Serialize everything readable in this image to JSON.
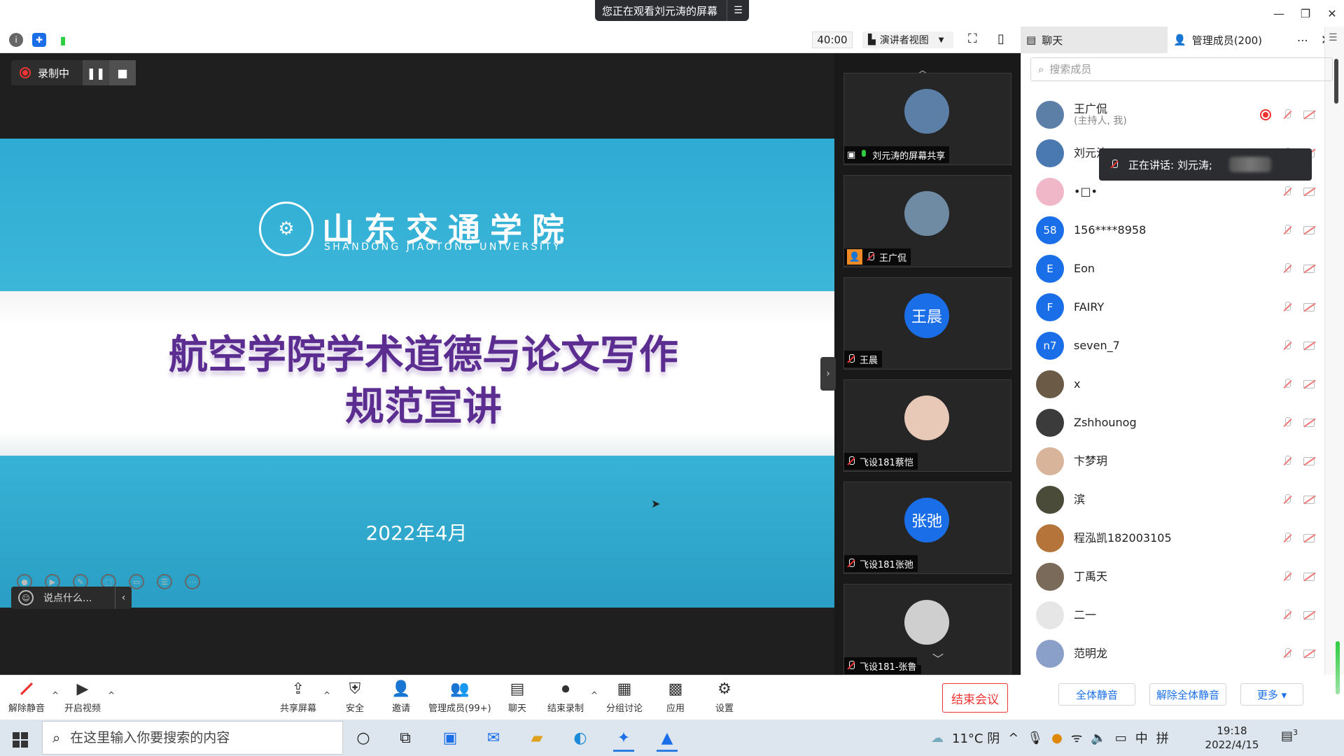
{
  "banner": {
    "text": "您正在观看刘元涛的屏幕",
    "menu_icon": "menu-icon"
  },
  "toolbar": {
    "timer": "40:00",
    "view_mode": "演讲者视图"
  },
  "recording": {
    "label": "录制中"
  },
  "slide": {
    "university_cn": "山东交通学院",
    "university_en": "SHANDONG JIAOTONG UNIVERSITY",
    "title_line1": "航空学院学术道德与论文写作",
    "title_line2": "规范宣讲",
    "date": "2022年4月"
  },
  "chat_input": {
    "placeholder": "说点什么..."
  },
  "gallery": [
    {
      "name": "刘元涛的屏幕共享",
      "avatar_text": "",
      "avatar_color": "#5b7fa6",
      "mic": "on",
      "sharing": true
    },
    {
      "name": "王广侃",
      "avatar_text": "",
      "avatar_color": "#6f8aa3",
      "mic": "off",
      "host_badge": true
    },
    {
      "name": "王晨",
      "avatar_text": "王晨",
      "avatar_color": "#1a6fe8",
      "mic": "off"
    },
    {
      "name": "飞设181蔡恺",
      "avatar_text": "",
      "avatar_color": "#e8c9b8",
      "mic": "off"
    },
    {
      "name": "飞设181张弛",
      "avatar_text": "张弛",
      "avatar_color": "#1a6fe8",
      "mic": "off"
    },
    {
      "name": "飞设181-张鲁",
      "avatar_text": "",
      "avatar_color": "#cfcfcf",
      "mic": "off"
    }
  ],
  "panel": {
    "tab_chat": "聊天",
    "tab_members": "管理成员(200)",
    "search_placeholder": "搜索成员",
    "speaking": "正在讲话: 刘元涛;",
    "members": [
      {
        "name": "王广侃",
        "sub": "(主持人, 我)",
        "avatar_text": "",
        "avatar_color": "#5b7fa6",
        "recording": true
      },
      {
        "name": "刘元涛",
        "sub": "",
        "avatar_text": "",
        "avatar_color": "#4a78b0"
      },
      {
        "name": "•□•",
        "sub": "",
        "avatar_text": "",
        "avatar_color": "#f0b7c8"
      },
      {
        "name": "156****8958",
        "sub": "",
        "avatar_text": "58",
        "avatar_color": "#1a6fe8"
      },
      {
        "name": "Eon",
        "sub": "",
        "avatar_text": "E",
        "avatar_color": "#1a6fe8"
      },
      {
        "name": "FAIRY",
        "sub": "",
        "avatar_text": "F",
        "avatar_color": "#1a6fe8"
      },
      {
        "name": "seven_7",
        "sub": "",
        "avatar_text": "n7",
        "avatar_color": "#1a6fe8"
      },
      {
        "name": "x",
        "sub": "",
        "avatar_text": "",
        "avatar_color": "#6b5a45"
      },
      {
        "name": "Zshhounog",
        "sub": "",
        "avatar_text": "",
        "avatar_color": "#3b3b3b"
      },
      {
        "name": "卞梦玥",
        "sub": "",
        "avatar_text": "",
        "avatar_color": "#d8b49a"
      },
      {
        "name": "滨",
        "sub": "",
        "avatar_text": "",
        "avatar_color": "#4b4b3a"
      },
      {
        "name": "程泓凯182003105",
        "sub": "",
        "avatar_text": "",
        "avatar_color": "#b5743a"
      },
      {
        "name": "丁禹天",
        "sub": "",
        "avatar_text": "",
        "avatar_color": "#7a6a5a"
      },
      {
        "name": "二一",
        "sub": "",
        "avatar_text": "",
        "avatar_color": "#e6e6e6"
      },
      {
        "name": "范明龙",
        "sub": "",
        "avatar_text": "",
        "avatar_color": "#8aa0c8"
      }
    ],
    "mute_all": "全体静音",
    "unmute_all": "解除全体静音",
    "more": "更多 ▾"
  },
  "controls": {
    "unmute": "解除静音",
    "start_video": "开启视频",
    "share_screen": "共享屏幕",
    "security": "安全",
    "invite": "邀请",
    "manage_members": "管理成员(99+)",
    "chat": "聊天",
    "end_recording": "结束录制",
    "breakout": "分组讨论",
    "apps": "应用",
    "settings": "设置",
    "end_meeting": "结束会议"
  },
  "taskbar": {
    "search_placeholder": "在这里输入你要搜索的内容",
    "weather": "11°C 阴",
    "ime_lang": "中",
    "ime_mode": "拼",
    "time": "19:18",
    "date": "2022/4/15",
    "notif_count": "3"
  }
}
